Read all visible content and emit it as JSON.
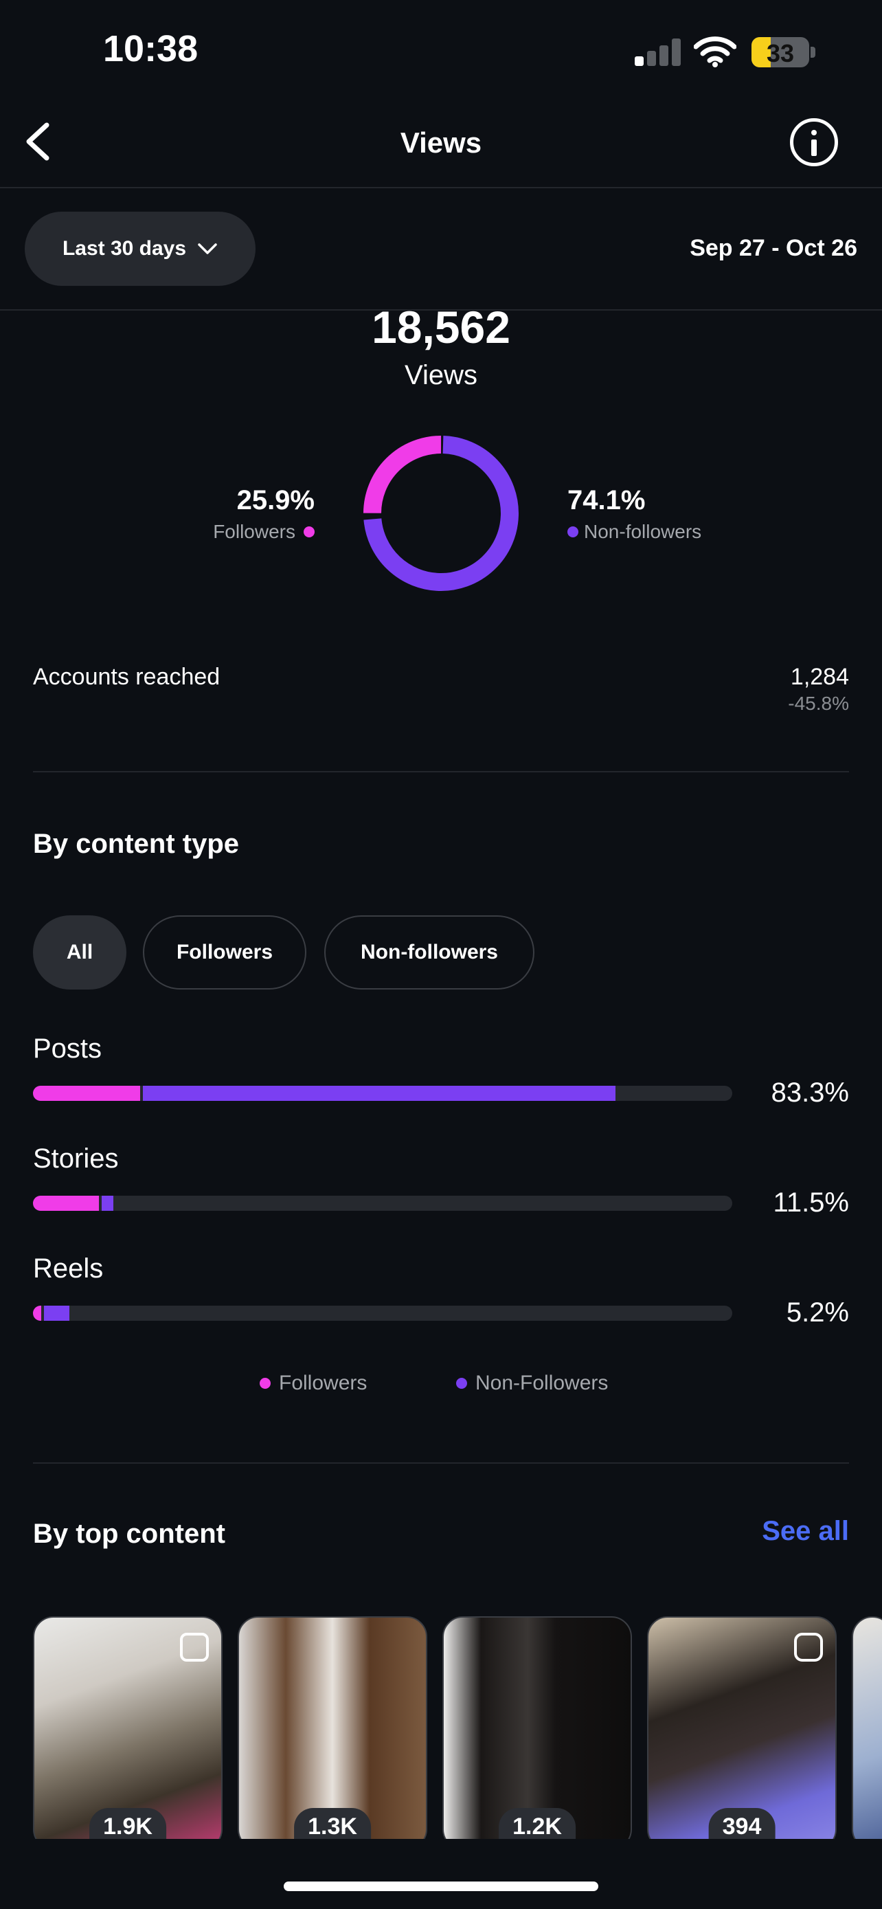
{
  "status_bar": {
    "time": "10:38",
    "battery": "33",
    "battery_level": 0.33
  },
  "header": {
    "title": "Views",
    "back_icon": "chevron-left-icon",
    "info_icon": "info-icon"
  },
  "filter": {
    "range_label": "Last 30 days",
    "date_range": "Sep 27 - Oct 26"
  },
  "summary": {
    "total": "18,562",
    "total_label": "Views",
    "followers_pct": "25.9%",
    "followers_label": "Followers",
    "non_followers_pct": "74.1%",
    "non_followers_label": "Non-followers",
    "followers_share": 0.259,
    "colors": {
      "followers": "#f03ce8",
      "non_followers": "#7b3ff2"
    }
  },
  "accounts_reached": {
    "label": "Accounts reached",
    "value": "1,284",
    "change": "-45.8%"
  },
  "by_content_type": {
    "title": "By content type",
    "tabs": [
      {
        "label": "All",
        "active": true
      },
      {
        "label": "Followers",
        "active": false
      },
      {
        "label": "Non-followers",
        "active": false
      }
    ],
    "rows": [
      {
        "label": "Posts",
        "pct": "83.3%",
        "followers": 15.3,
        "non_followers": 68.0
      },
      {
        "label": "Stories",
        "pct": "11.5%",
        "followers": 9.4,
        "non_followers": 2.1
      },
      {
        "label": "Reels",
        "pct": "5.2%",
        "followers": 1.2,
        "non_followers": 4.0
      }
    ],
    "legend": {
      "followers": "Followers",
      "non_followers": "Non-Followers"
    }
  },
  "top_content": {
    "title": "By top content",
    "see_all": "See all",
    "items": [
      {
        "count": "1.9K",
        "type_icon": "carousel-icon"
      },
      {
        "count": "1.3K",
        "type_icon": ""
      },
      {
        "count": "1.2K",
        "type_icon": ""
      },
      {
        "count": "394",
        "type_icon": "reels-icon"
      }
    ]
  }
}
